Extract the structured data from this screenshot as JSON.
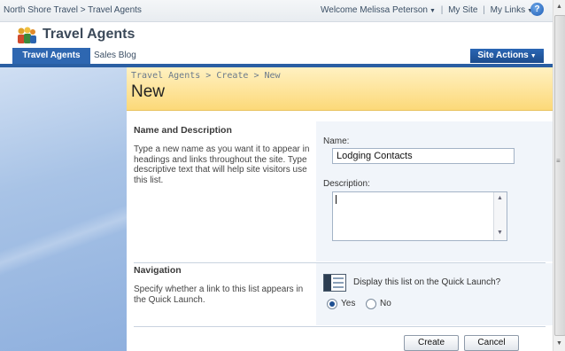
{
  "topbar": {
    "breadcrumb": "North Shore Travel > Travel Agents",
    "welcome": "Welcome Melissa Peterson",
    "my_site": "My Site",
    "my_links": "My Links"
  },
  "site": {
    "title": "Travel Agents"
  },
  "tabs": [
    {
      "label": "Travel Agents",
      "selected": true
    },
    {
      "label": "Sales Blog",
      "selected": false
    }
  ],
  "site_actions": "Site Actions",
  "page": {
    "breadcrumb": "Travel Agents > Create > New",
    "title": "New"
  },
  "name_description": {
    "heading": "Name and Description",
    "description": "Type a new name as you want it to appear in headings and links throughout the site. Type descriptive text that will help site visitors use this list.",
    "name_label": "Name:",
    "name_value": "Lodging Contacts",
    "description_label": "Description:",
    "description_value": ""
  },
  "navigation": {
    "heading": "Navigation",
    "description": "Specify whether a link to this list appears in the Quick Launch.",
    "quicklaunch_label": "Display this list on the Quick Launch?",
    "yes_label": "Yes",
    "no_label": "No",
    "selected": "Yes"
  },
  "buttons": {
    "create": "Create",
    "cancel": "Cancel"
  },
  "colors": {
    "tab_active": "#2e67b1",
    "header_gradient_top": "#fff1c2",
    "header_gradient_bottom": "#fcd979",
    "left_panel": "#a8c3e6"
  }
}
